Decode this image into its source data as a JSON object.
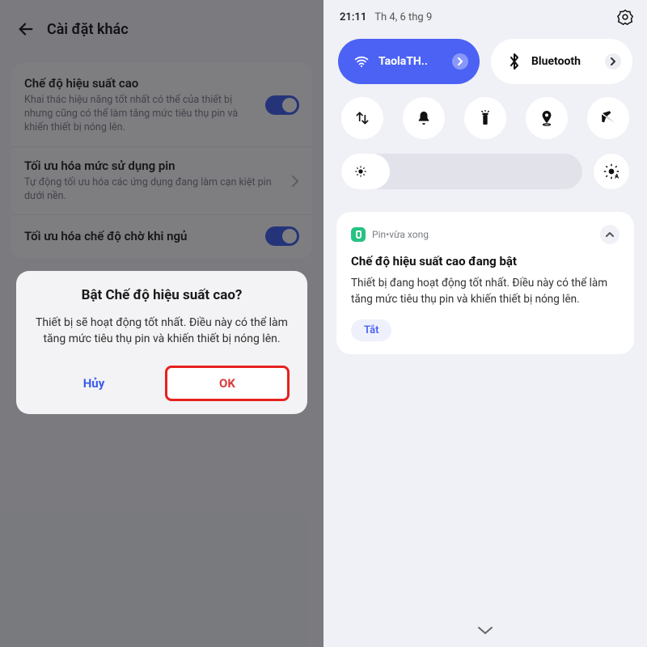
{
  "left": {
    "header_title": "Cài đặt khác",
    "item_highperf": {
      "title": "Chế độ hiệu suất cao",
      "sub": "Khai thác hiệu năng tốt nhất có thể của thiết bị nhưng cũng có thể làm tăng mức tiêu thụ pin và khiến thiết bị nóng lên."
    },
    "item_batteryopt": {
      "title": "Tối ưu hóa mức sử dụng pin",
      "sub": "Tự động tối ưu hóa các ứng dụng đang làm cạn kiệt pin dưới nền."
    },
    "item_sleepopt_title": "Tối ưu hóa chế độ chờ khi ngủ",
    "dialog": {
      "title": "Bật Chế độ hiệu suất cao?",
      "body": "Thiết bị sẽ hoạt động tốt nhất. Điều này có thể làm tăng mức tiêu thụ pin và khiến thiết bị nóng lên.",
      "cancel": "Hủy",
      "ok": "OK"
    }
  },
  "right": {
    "time": "21:11",
    "date": "Th 4, 6 thg 9",
    "wifi_label": "TaolaTH..",
    "bt_label": "Bluetooth",
    "notification": {
      "app": "Pin",
      "sep": " • ",
      "when": "vừa xong",
      "title": "Chế độ hiệu suất cao đang bật",
      "body": "Thiết bị đang hoạt động tốt nhất. Điều này có thể làm tăng mức tiêu thụ pin và khiến thiết bị nóng lên.",
      "action": "Tắt"
    }
  }
}
